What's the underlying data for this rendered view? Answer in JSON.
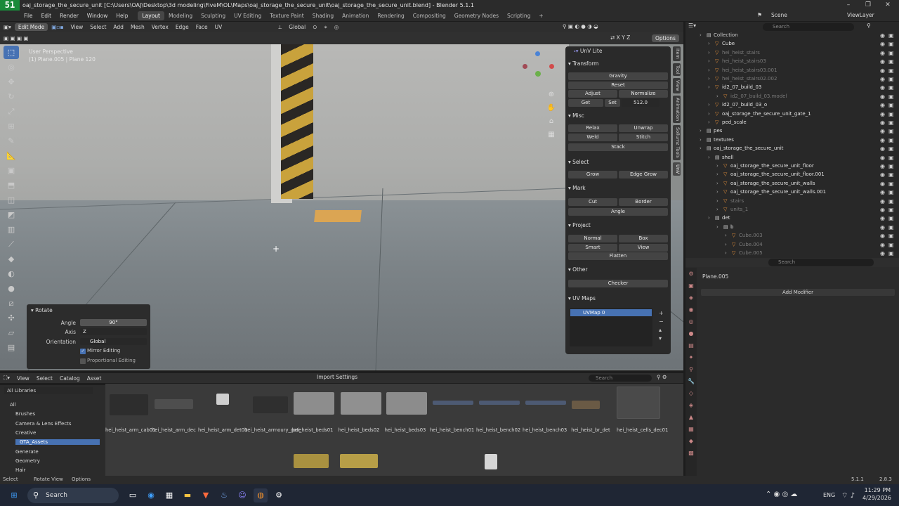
{
  "title_bar": {
    "logo": "51",
    "title": "oaj_storage_the_secure_unit [C:\\Users\\OAJ\\Desktop\\3d modeling\\FiveM\\OL\\Maps\\oaj_storage_the_secure_unit\\oaj_storage_the_secure_unit.blend] - Blender 5.1.1"
  },
  "menu": [
    "File",
    "Edit",
    "Render",
    "Window",
    "Help"
  ],
  "workspaces": [
    "Layout",
    "Modeling",
    "Sculpting",
    "UV Editing",
    "Texture Paint",
    "Shading",
    "Animation",
    "Rendering",
    "Compositing",
    "Geometry Nodes",
    "Scripting"
  ],
  "active_workspace": "Layout",
  "scene": "Scene",
  "view_layer": "ViewLayer",
  "viewport_header": {
    "mode": "Edit Mode",
    "menus": [
      "View",
      "Select",
      "Add",
      "Mesh",
      "Vertex",
      "Edge",
      "Face",
      "UV"
    ],
    "orientation": "Global",
    "options": "Options"
  },
  "viewport": {
    "perspective": "User Perspective",
    "object_info": "(1) Plane.005 | Plane 120"
  },
  "operator_panel": {
    "title": "Rotate",
    "angle_label": "Angle",
    "angle_value": "90°",
    "axis_label": "Axis",
    "axis_value": "Z",
    "orientation_label": "Orientation",
    "orientation_value": "Global",
    "mirror_editing": "Mirror Editing",
    "proportional_editing": "Proportional Editing"
  },
  "uv_panel": {
    "title": "UnV Lite",
    "transform": "Transform",
    "gravity": "Gravity",
    "reset": "Reset",
    "adjust": "Adjust",
    "normalize": "Normalize",
    "get": "Get",
    "set": "Set",
    "set_value": "512.0",
    "misc": "Misc",
    "relax": "Relax",
    "unwrap": "Unwrap",
    "weld": "Weld",
    "stitch": "Stitch",
    "stack": "Stack",
    "select": "Select",
    "grow": "Grow",
    "edge_grow": "Edge Grow",
    "mark": "Mark",
    "cut": "Cut",
    "border": "Border",
    "angle": "Angle",
    "project": "Project",
    "normal": "Normal",
    "box": "Box",
    "smart": "Smart",
    "view": "View",
    "flatten": "Flatten",
    "other": "Other",
    "checker": "Checker",
    "uv_maps": "UV Maps",
    "uvmap0": "UVMap 0"
  },
  "side_tabs": [
    "Item",
    "Tool",
    "View",
    "Animation",
    "Sollumz Tools",
    "UnV"
  ],
  "outliner": {
    "search_placeholder": "Search",
    "rows": [
      {
        "label": "Collection",
        "indent": 0,
        "color": "#cfcfcf"
      },
      {
        "label": "Cube",
        "indent": 1,
        "color": "#e0e0e0"
      },
      {
        "label": "hei_heist_stairs",
        "indent": 1,
        "color": "#7a7a7a"
      },
      {
        "label": "hei_heist_stairs03",
        "indent": 1,
        "color": "#7a7a7a"
      },
      {
        "label": "hei_heist_stairs03.001",
        "indent": 1,
        "color": "#7a7a7a"
      },
      {
        "label": "hei_heist_stairs02.002",
        "indent": 1,
        "color": "#7a7a7a"
      },
      {
        "label": "id2_07_build_03",
        "indent": 1,
        "color": "#e0e0e0"
      },
      {
        "label": "id2_07_build_03.model",
        "indent": 2,
        "color": "#7a7a7a"
      },
      {
        "label": "id2_07_build_03_o",
        "indent": 1,
        "color": "#e0e0e0"
      },
      {
        "label": "oaj_storage_the_secure_unit_gate_1",
        "indent": 1,
        "color": "#e0e0e0"
      },
      {
        "label": "ped_scale",
        "indent": 1,
        "color": "#e0e0e0"
      },
      {
        "label": "pes",
        "indent": 0,
        "color": "#e0e0e0"
      },
      {
        "label": "textures",
        "indent": 0,
        "color": "#e0e0e0"
      },
      {
        "label": "oaj_storage_the_secure_unit",
        "indent": 0,
        "color": "#e0e0e0"
      },
      {
        "label": "shell",
        "indent": 1,
        "color": "#e0e0e0"
      },
      {
        "label": "oaj_storage_the_secure_unit_floor",
        "indent": 2,
        "color": "#e0e0e0"
      },
      {
        "label": "oaj_storage_the_secure_unit_floor.001",
        "indent": 2,
        "color": "#e0e0e0"
      },
      {
        "label": "oaj_storage_the_secure_unit_walls",
        "indent": 2,
        "color": "#e0e0e0"
      },
      {
        "label": "oaj_storage_the_secure_unit_walls.001",
        "indent": 2,
        "color": "#e0e0e0"
      },
      {
        "label": "stairs",
        "indent": 2,
        "color": "#7a7a7a"
      },
      {
        "label": "units_1",
        "indent": 2,
        "color": "#7a7a7a"
      },
      {
        "label": "det",
        "indent": 1,
        "color": "#e0e0e0"
      },
      {
        "label": "b",
        "indent": 2,
        "color": "#e0e0e0"
      },
      {
        "label": "Cube.003",
        "indent": 3,
        "color": "#7a7a7a"
      },
      {
        "label": "Cube.004",
        "indent": 3,
        "color": "#7a7a7a"
      },
      {
        "label": "Cube.005",
        "indent": 3,
        "color": "#7a7a7a"
      }
    ]
  },
  "properties": {
    "search_placeholder": "Search",
    "object": "Plane.005",
    "add_modifier": "Add Modifier"
  },
  "asset_browser": {
    "menus": [
      "View",
      "Select",
      "Catalog",
      "Asset"
    ],
    "import_settings": "Import Settings",
    "search_placeholder": "Search",
    "library": "All Libraries",
    "tree": [
      "All",
      "Brushes",
      "Camera & Lens Effects",
      "Creative",
      "GTA_Assets",
      "Generate",
      "Geometry",
      "Hair"
    ],
    "selected_tree": "GTA_Assets",
    "assets": [
      "hei_heist_arm_cab01",
      "hei_heist_arm_dec",
      "hei_heist_arm_det01",
      "hei_heist_armoury_gate",
      "hei_heist_beds01",
      "hei_heist_beds02",
      "hei_heist_beds03",
      "hei_heist_bench01",
      "hei_heist_bench02",
      "hei_heist_bench03",
      "hei_heist_br_det",
      "hei_heist_cells_dec01"
    ]
  },
  "status_bar": {
    "select": "Select",
    "rotate_view": "Rotate View",
    "options": "Options",
    "version": "5.1.1",
    "version2": "2.8.3"
  },
  "taskbar": {
    "search": "Search",
    "lang": "ENG",
    "time": "11:29 PM",
    "date": "4/29/2026"
  }
}
